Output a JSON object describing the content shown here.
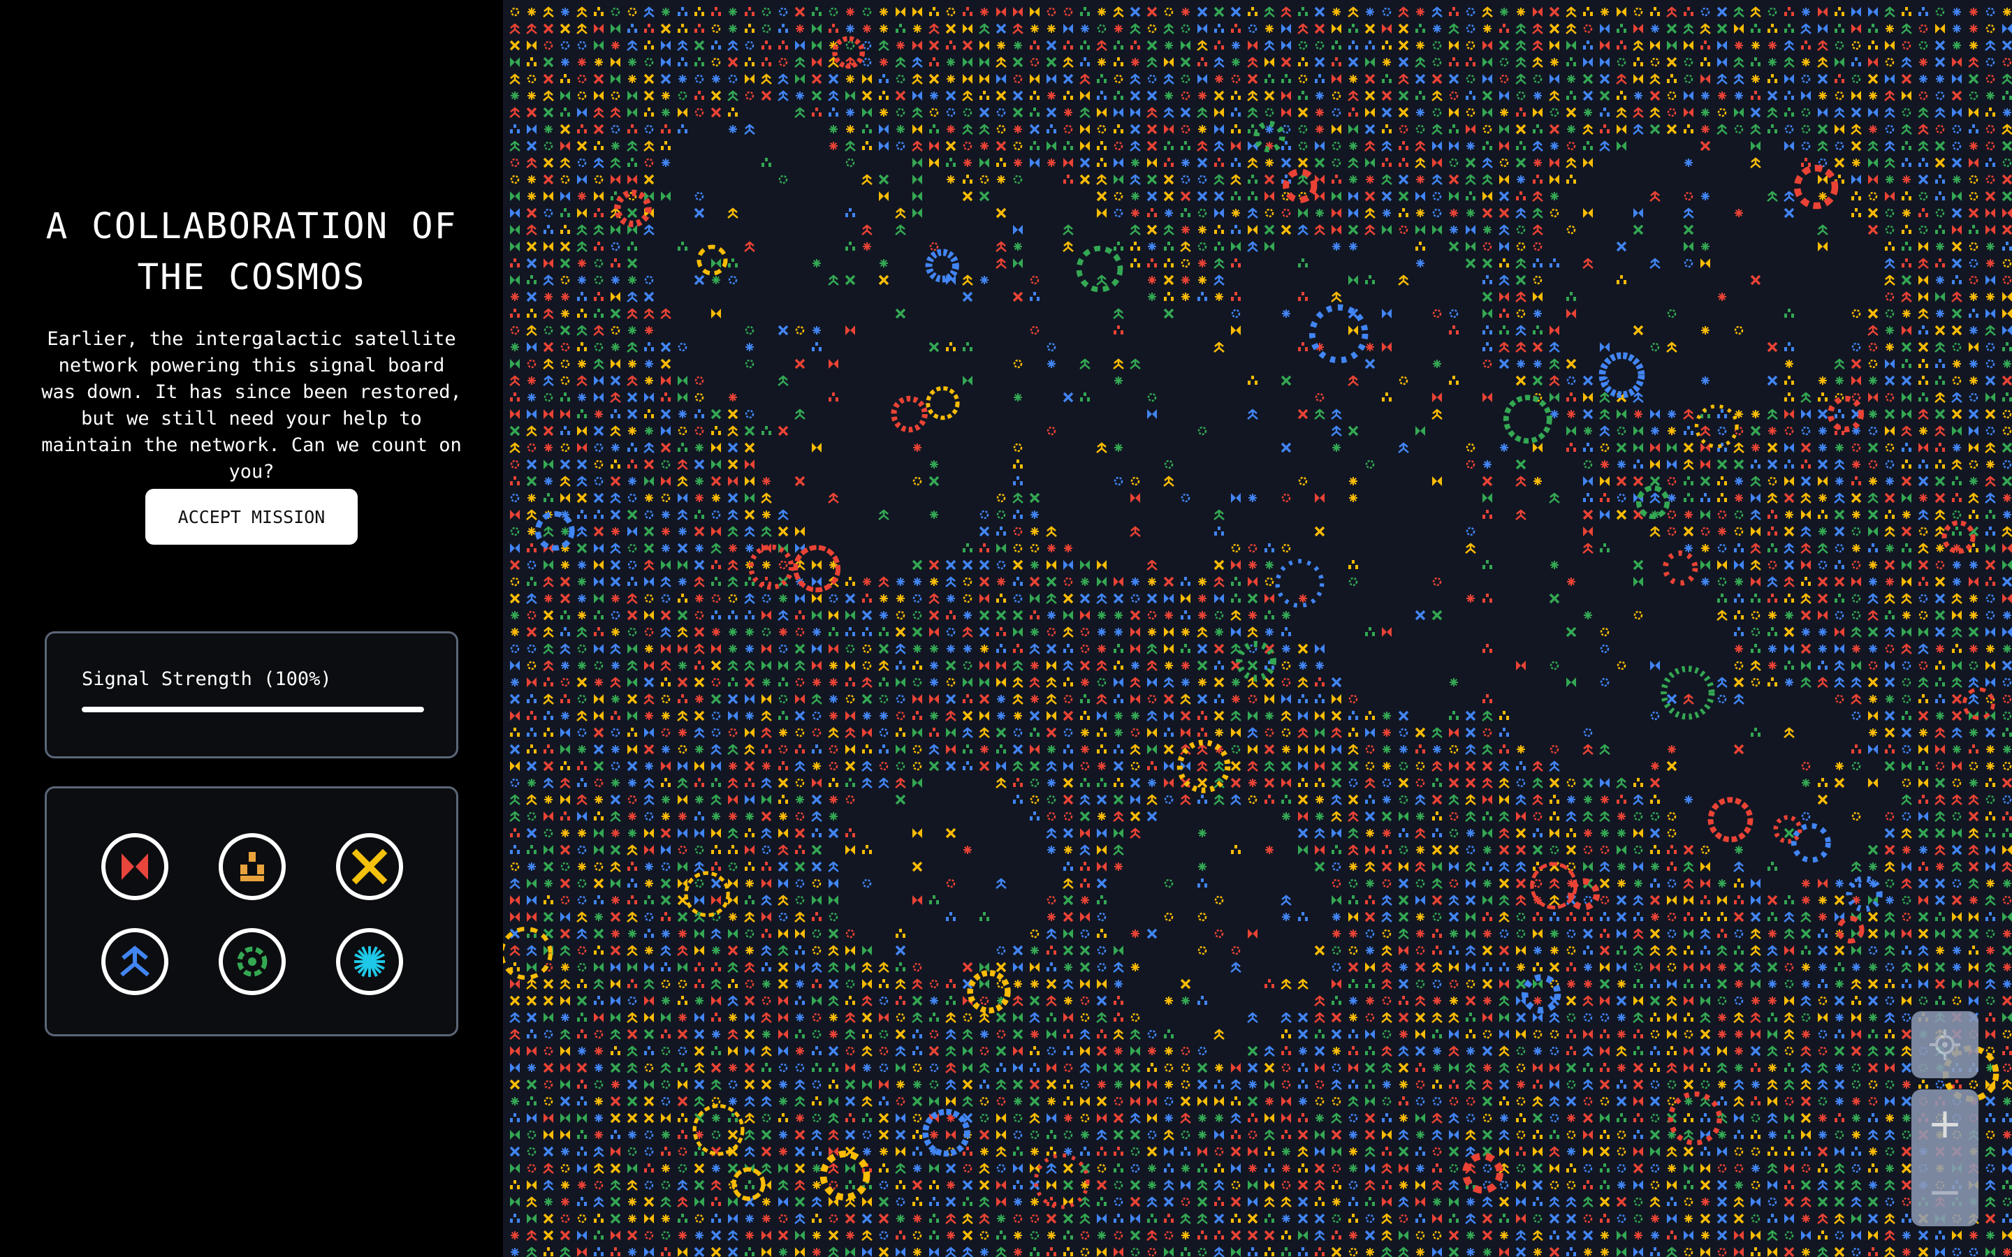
{
  "sidebar": {
    "title_line1": "A COLLABORATION OF",
    "title_line2": "THE COSMOS",
    "description": "Earlier, the intergalactic satellite network powering this signal board was down. It has since been restored, but we still need your help to maintain the network. Can we count on you?",
    "accept_label": "ACCEPT MISSION"
  },
  "signal": {
    "label": "Signal Strength (100%)",
    "value": 1.0
  },
  "icons": [
    {
      "name": "red-bowtie-icon",
      "color": "#e8453c"
    },
    {
      "name": "orange-blocks-icon",
      "color": "#e8a33c"
    },
    {
      "name": "yellow-x-icon",
      "color": "#f4c20d"
    },
    {
      "name": "blue-chevrons-icon",
      "color": "#4285f4"
    },
    {
      "name": "green-swirl-icon",
      "color": "#34a853"
    },
    {
      "name": "cyan-starburst-icon",
      "color": "#1ec8e8"
    }
  ],
  "board": {
    "background": "#111622",
    "palette": [
      "#4285f4",
      "#ea4335",
      "#fbbc05",
      "#34a853"
    ]
  },
  "controls": {
    "locate_icon": "crosshair-icon",
    "zoom_in_label": "+",
    "zoom_out_label": "−"
  }
}
